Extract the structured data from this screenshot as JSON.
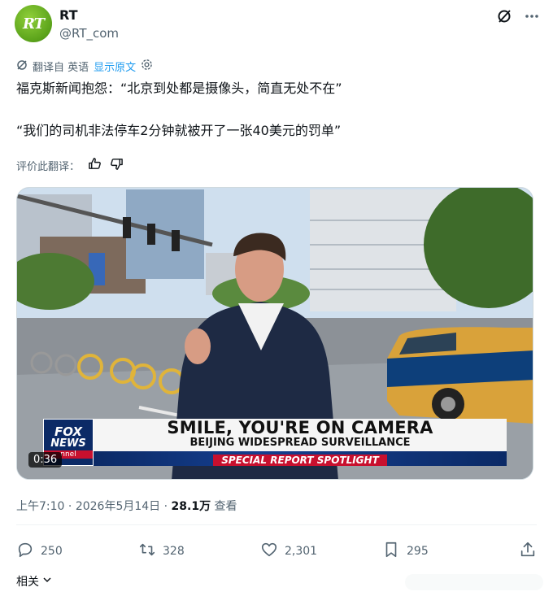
{
  "account": {
    "avatar_text": "RT",
    "name": "RT",
    "handle": "@RT_com"
  },
  "translation": {
    "source_label": "翻译自 英语",
    "show_original": "显示原文"
  },
  "tweet": {
    "line1": "福克斯新闻抱怨：“北京到处都是摄像头，简直无处不在”",
    "line2": "“我们的司机非法停车2分钟就被开了一张40美元的罚单”"
  },
  "rate": {
    "label": "评价此翻译："
  },
  "media": {
    "fox_logo_line1": "FOX",
    "fox_logo_line2": "NEWS",
    "fox_logo_line3": "nnel",
    "caption_headline": "SMILE, YOU'RE ON CAMERA",
    "caption_sub": "BEIJING WIDESPREAD SURVEILLANCE",
    "caption_banner": "SPECIAL REPORT SPOTLIGHT",
    "duration": "0:36"
  },
  "meta": {
    "time": "上午7:10",
    "separator1": " · ",
    "date": "2026年5月14日",
    "separator2": " · ",
    "views_count": "28.1万",
    "views_label": " 查看"
  },
  "actions": {
    "replies": "250",
    "reposts": "328",
    "likes": "2,301",
    "bookmarks": "295"
  },
  "related": {
    "label": "相关"
  },
  "icons": {
    "grok": "grok-icon",
    "more": "more-icon",
    "translate": "translate-icon",
    "settings": "gear-icon",
    "thumb_up": "thumb-up-icon",
    "thumb_down": "thumb-down-icon",
    "reply": "reply-icon",
    "repost": "repost-icon",
    "like": "heart-icon",
    "bookmark": "bookmark-icon",
    "share": "share-icon"
  },
  "colors": {
    "link": "#1d9bf0",
    "muted": "#536471",
    "text": "#0f1419",
    "fox_blue": "#0b2a66",
    "fox_red": "#c8102e"
  }
}
